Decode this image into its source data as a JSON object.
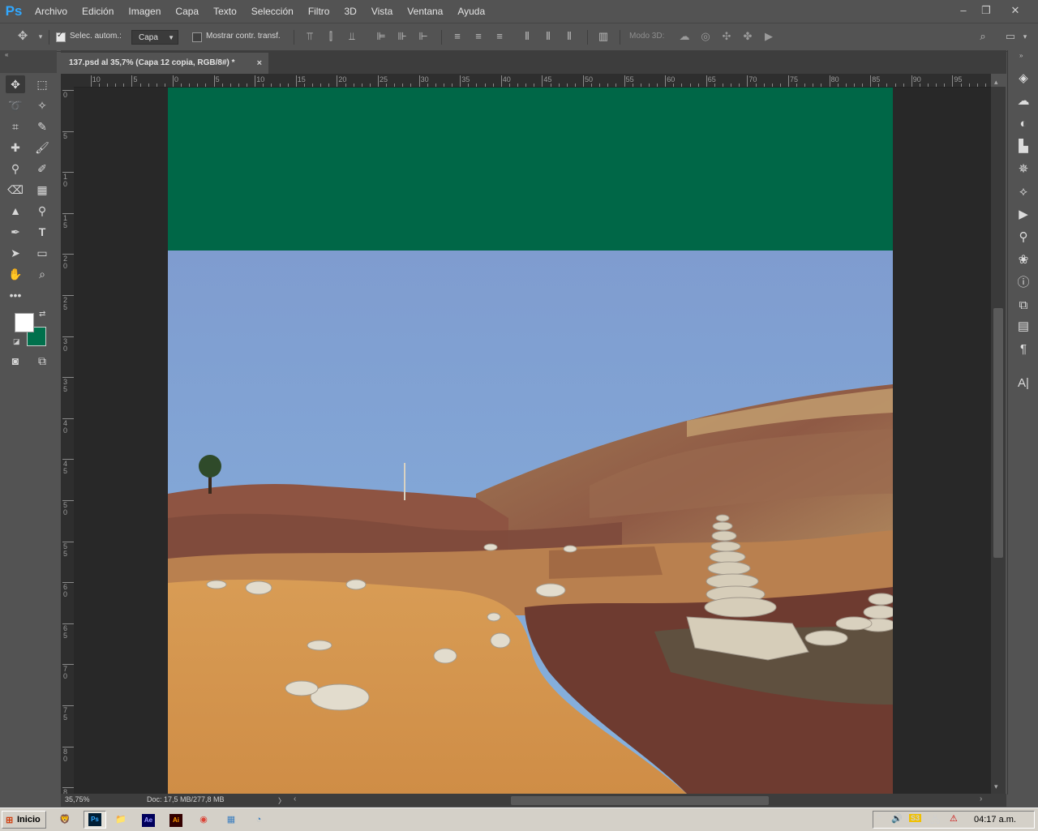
{
  "app": {
    "logo": "Ps",
    "menu": [
      "Archivo",
      "Edición",
      "Imagen",
      "Capa",
      "Texto",
      "Selección",
      "Filtro",
      "3D",
      "Vista",
      "Ventana",
      "Ayuda"
    ]
  },
  "window_controls": {
    "minimize": "–",
    "restore": "❐",
    "close": "✕"
  },
  "options_bar": {
    "auto_select_label": "Selec. autom.:",
    "auto_select_checked": true,
    "target_value": "Capa",
    "show_transform_label": "Mostrar contr. transf.",
    "show_transform_checked": false,
    "mode_3d_label": "Modo 3D:"
  },
  "document_tab": {
    "title": "137.psd al 35,7% (Capa 12 copia, RGB/8#) *",
    "close": "×"
  },
  "ruler": {
    "h_labels": [
      "10",
      "5",
      "0",
      "5",
      "10",
      "15",
      "20",
      "25",
      "30",
      "35",
      "40",
      "45",
      "50",
      "55",
      "60",
      "65",
      "70",
      "75",
      "80",
      "85",
      "90",
      "95"
    ],
    "v_labels": [
      "0",
      "5",
      "10",
      "15",
      "20",
      "25",
      "30",
      "35",
      "40",
      "45",
      "50",
      "55",
      "60",
      "65",
      "70",
      "75",
      "80",
      "8"
    ]
  },
  "canvas": {
    "band_color": "#006747",
    "foreground_color": "#ffffff",
    "background_color": "#00704c"
  },
  "status": {
    "zoom": "35,75%",
    "doc_size": "Doc: 17,5 MB/277,8 MB",
    "arrow": "〉"
  },
  "taskbar": {
    "start_label": "Inicio",
    "apps": [
      "Brave",
      "Ps",
      "Explorador",
      "Ae",
      "Ai",
      "Chrome",
      "Notas",
      "Visor"
    ],
    "clock": "04:17 a.m."
  },
  "tray_icons": [
    "^",
    "🔊",
    "S3",
    "🖧",
    "⚠"
  ]
}
